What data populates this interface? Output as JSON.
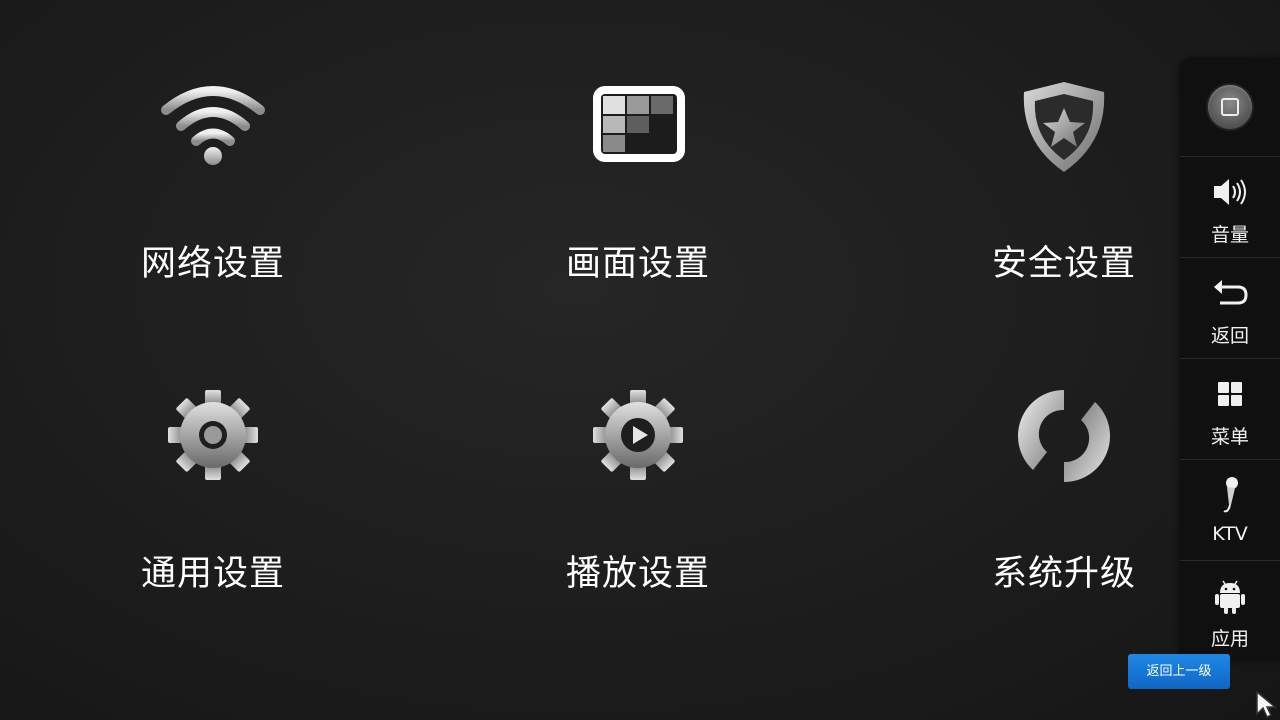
{
  "tiles": [
    {
      "label": "网络设置",
      "icon": "wifi-icon"
    },
    {
      "label": "画面设置",
      "icon": "picture-icon"
    },
    {
      "label": "安全设置",
      "icon": "shield-star-icon"
    },
    {
      "label": "通用设置",
      "icon": "gear-icon"
    },
    {
      "label": "播放设置",
      "icon": "gear-play-icon"
    },
    {
      "label": "系统升级",
      "icon": "refresh-icon"
    }
  ],
  "sidebar": {
    "items": [
      {
        "label": "",
        "icon": "home-icon"
      },
      {
        "label": "音量",
        "icon": "volume-icon"
      },
      {
        "label": "返回",
        "icon": "back-arrow-icon"
      },
      {
        "label": "菜单",
        "icon": "menu-grid-icon"
      },
      {
        "label": "KTV",
        "icon": "microphone-icon"
      },
      {
        "label": "应用",
        "icon": "android-icon"
      }
    ]
  },
  "back_up_label": "返回上一级",
  "colors": {
    "accent": "#1976d2",
    "background": "#1e1e1e",
    "sidebar": "#101010"
  }
}
